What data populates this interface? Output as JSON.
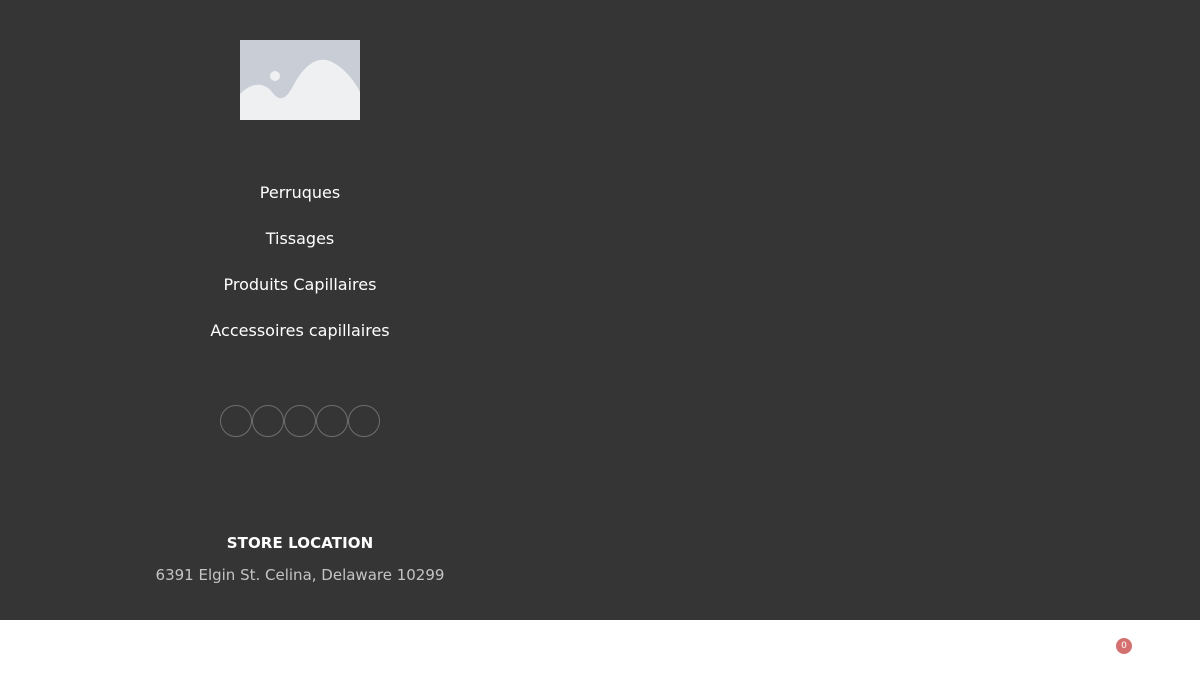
{
  "logo": {
    "icon": "image-placeholder-icon"
  },
  "nav": {
    "items": [
      {
        "label": "Perruques"
      },
      {
        "label": "Tissages"
      },
      {
        "label": "Produits Capillaires"
      },
      {
        "label": "Accessoires capillaires"
      }
    ]
  },
  "social": {
    "icons": [
      "social-icon-1",
      "social-icon-2",
      "social-icon-3",
      "social-icon-4",
      "social-icon-5"
    ]
  },
  "store": {
    "title": "STORE LOCATION",
    "address": "6391 Elgin St. Celina, Delaware 10299"
  },
  "cart": {
    "count": "0"
  },
  "colors": {
    "footer_bg": "#353535",
    "badge_bg": "#d47070",
    "circle_border": "#6e6e6e",
    "address_text": "#c4c4c4"
  }
}
